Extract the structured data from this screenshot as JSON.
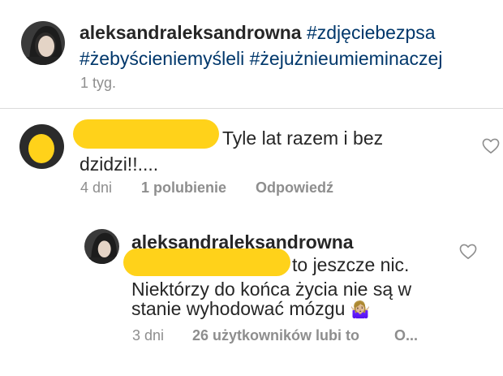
{
  "caption": {
    "username": "aleksandraleksandrowna",
    "hashtag_1": "#zdjęciebezpsa",
    "hashtag_2": "#żebyścieniemyśleli",
    "hashtag_3": "#żejużnieumieminaczej",
    "time": "1 tyg."
  },
  "comment": {
    "text_line1": "Tyle lat razem i bez",
    "text_line2": "dzidzi!!....",
    "time": "4 dni",
    "likes": "1 polubienie",
    "reply": "Odpowiedź"
  },
  "reply": {
    "username": "aleksandraleksandrowna",
    "text_line1": "to jeszcze nic.",
    "text_line2": "Niektórzy do końca życia nie są w",
    "text_line3": "stanie wyhodować mózgu",
    "emoji": "🤷🏼‍♀️",
    "time": "3 dni",
    "likes": "26 użytkowników lubi to",
    "more": "O..."
  },
  "colors": {
    "redaction": "#ffd21a",
    "hashtag": "#00376b",
    "muted": "#8e8e8e"
  }
}
